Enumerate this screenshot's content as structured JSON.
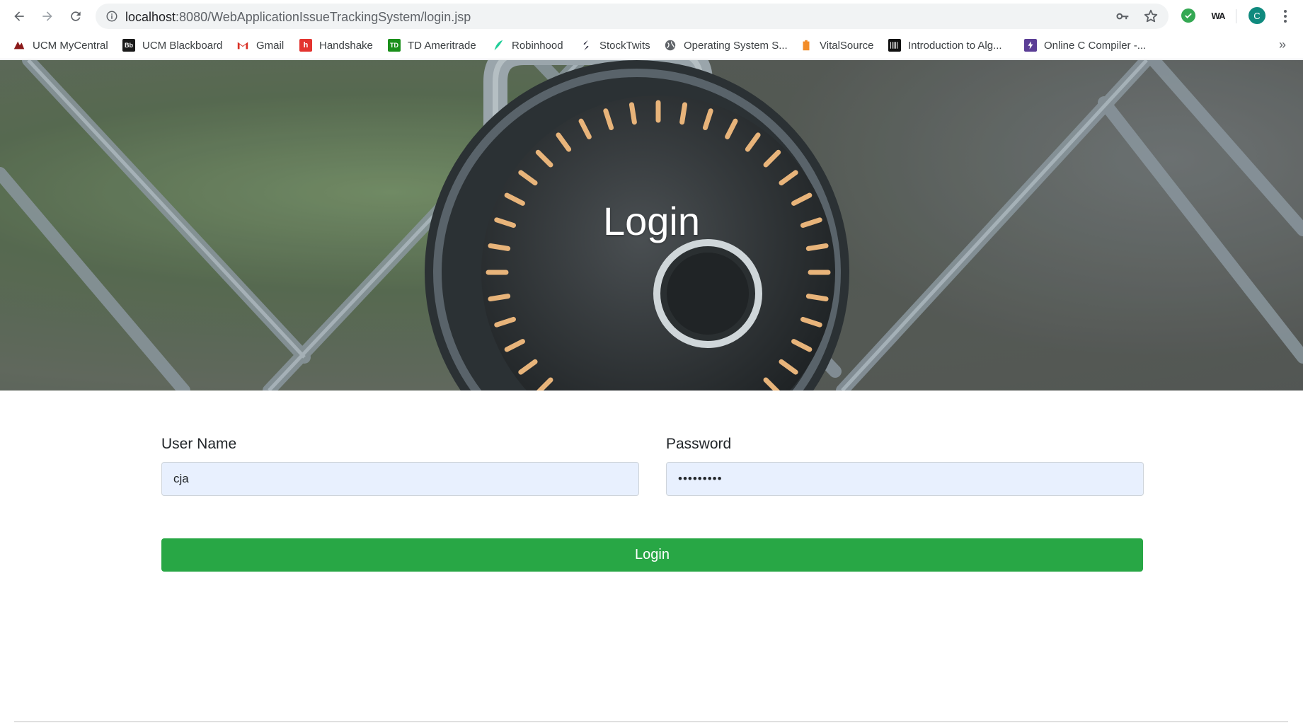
{
  "browser": {
    "url_host": "localhost",
    "url_rest": ":8080/WebApplicationIssueTrackingSystem/login.jsp",
    "avatar_letter": "C",
    "extension_label": "WA",
    "icons": [
      "back-icon",
      "forward-icon",
      "reload-icon",
      "info-icon",
      "key-icon",
      "star-icon",
      "check-extension-icon",
      "menu-icon"
    ]
  },
  "bookmarks": [
    {
      "label": "UCM MyCentral",
      "icon": "ucm-icon",
      "color": "#8b1a1a"
    },
    {
      "label": "UCM Blackboard",
      "icon": "blackboard-icon",
      "color": "#1a1a1a"
    },
    {
      "label": "Gmail",
      "icon": "gmail-icon",
      "color": "#d93025"
    },
    {
      "label": "Handshake",
      "icon": "handshake-icon",
      "color": "#e3342f"
    },
    {
      "label": "TD Ameritrade",
      "icon": "td-icon",
      "color": "#1a8f1a"
    },
    {
      "label": "Robinhood",
      "icon": "robinhood-icon",
      "color": "#21ce99"
    },
    {
      "label": "StockTwits",
      "icon": "stocktwits-icon",
      "color": "#1a73e8"
    },
    {
      "label": "Operating System S...",
      "icon": "globe-icon",
      "color": "#5f6368"
    },
    {
      "label": "VitalSource",
      "icon": "vitalsource-icon",
      "color": "#f28c28"
    },
    {
      "label": "Introduction to Alg...",
      "icon": "book-icon",
      "color": "#111111"
    },
    {
      "label": "Online C Compiler -...",
      "icon": "compiler-icon",
      "color": "#5b3e96"
    }
  ],
  "hero": {
    "title": "Login"
  },
  "form": {
    "username_label": "User Name",
    "username_value": "cja",
    "password_label": "Password",
    "password_value": "•••••••••",
    "submit_label": "Login",
    "submit_color": "#28a745",
    "input_bg": "#e8f0fe"
  }
}
